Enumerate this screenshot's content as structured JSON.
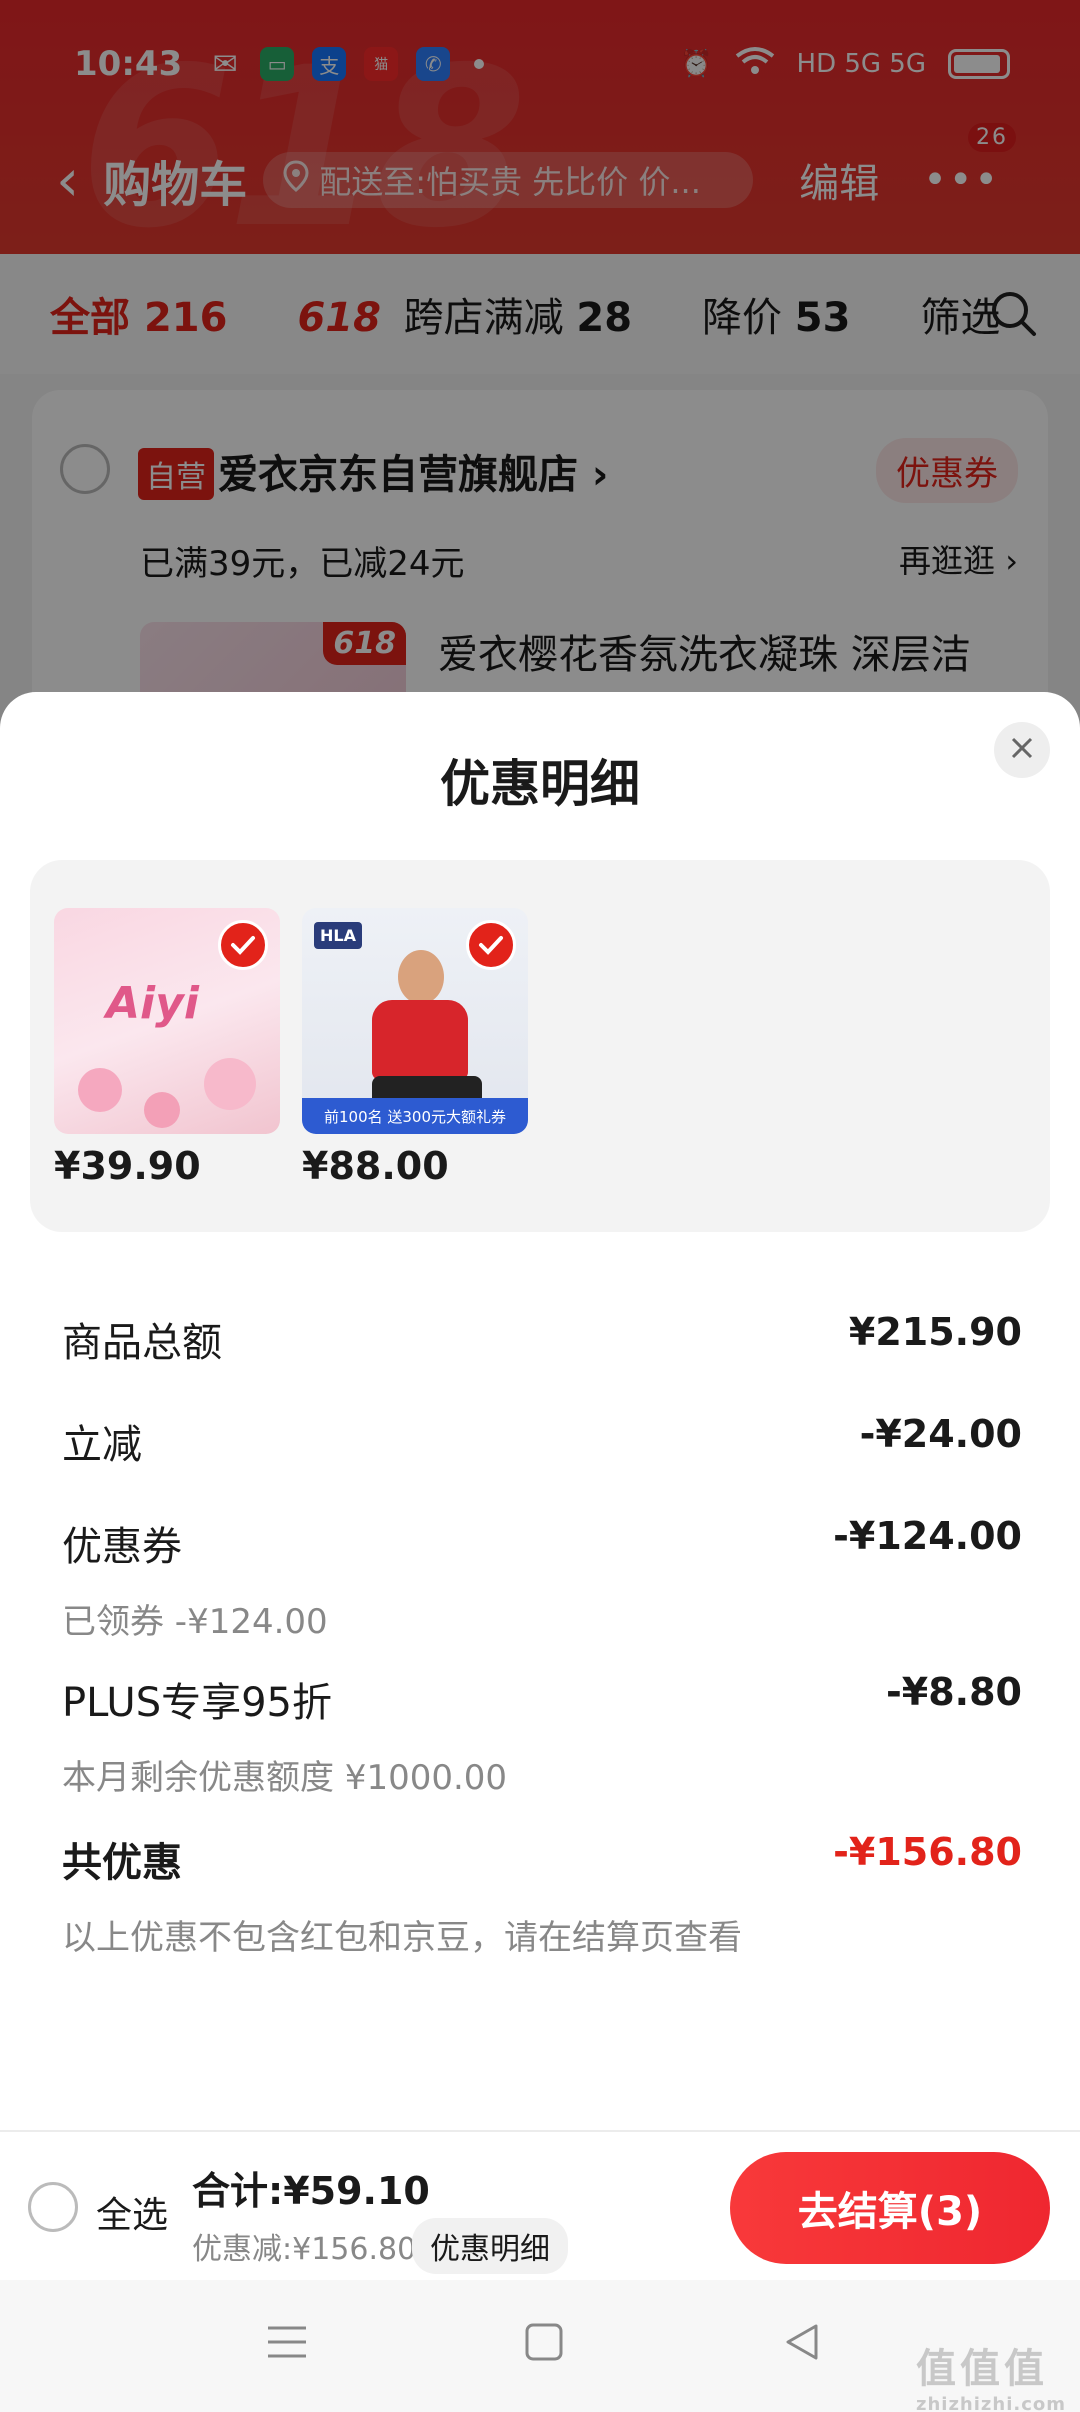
{
  "status": {
    "time": "10:43",
    "network": "HD 5G 5G"
  },
  "header": {
    "title": "购物车",
    "address": "配送至:怕买贵 先比价 价...",
    "edit": "编辑",
    "badge_count": "26"
  },
  "filters": [
    {
      "label": "全部",
      "count": "216"
    },
    {
      "tag": "618",
      "label": "跨店满减",
      "count": "28"
    },
    {
      "label": "降价",
      "count": "53"
    },
    {
      "label": "筛选"
    }
  ],
  "store": {
    "self_badge": "自营",
    "name": "爱衣京东自营旗舰店 ›",
    "coupon": "优惠券",
    "promo": "已满39元，已减24元",
    "go_around": "再逛逛 ›",
    "product_badge": "618",
    "product_title": "爱衣樱花香氛洗衣凝珠 深层洁"
  },
  "sheet": {
    "title": "优惠明细",
    "products": [
      {
        "price": "¥39.90",
        "brand": "Aiyi"
      },
      {
        "price": "¥88.00",
        "brand": "HLA",
        "banner": "前100名 送300元大额礼券"
      }
    ],
    "rows": {
      "subtotal": {
        "label": "商品总额",
        "value": "¥215.90"
      },
      "instant": {
        "label": "立减",
        "value": "-¥24.00"
      },
      "coupon": {
        "label": "优惠券",
        "value": "-¥124.00",
        "sub": "已领券 -¥124.00"
      },
      "plus": {
        "label": "PLUS专享95折",
        "value": "-¥8.80",
        "sub": "本月剩余优惠额度 ¥1000.00"
      },
      "total": {
        "label": "共优惠",
        "value": "-¥156.80",
        "sub": "以上优惠不包含红包和京豆，请在结算页查看"
      }
    }
  },
  "checkout": {
    "select_all": "全选",
    "total": "合计:¥59.10",
    "discount": "优惠减:¥156.80",
    "detail_button": "优惠明细",
    "pay_button": "去结算(3)"
  },
  "watermark": {
    "main": "值值值",
    "sub": "zhizhizhi.com"
  },
  "colors": {
    "brand_red": "#e2231a",
    "header_red": "#e8282b"
  }
}
